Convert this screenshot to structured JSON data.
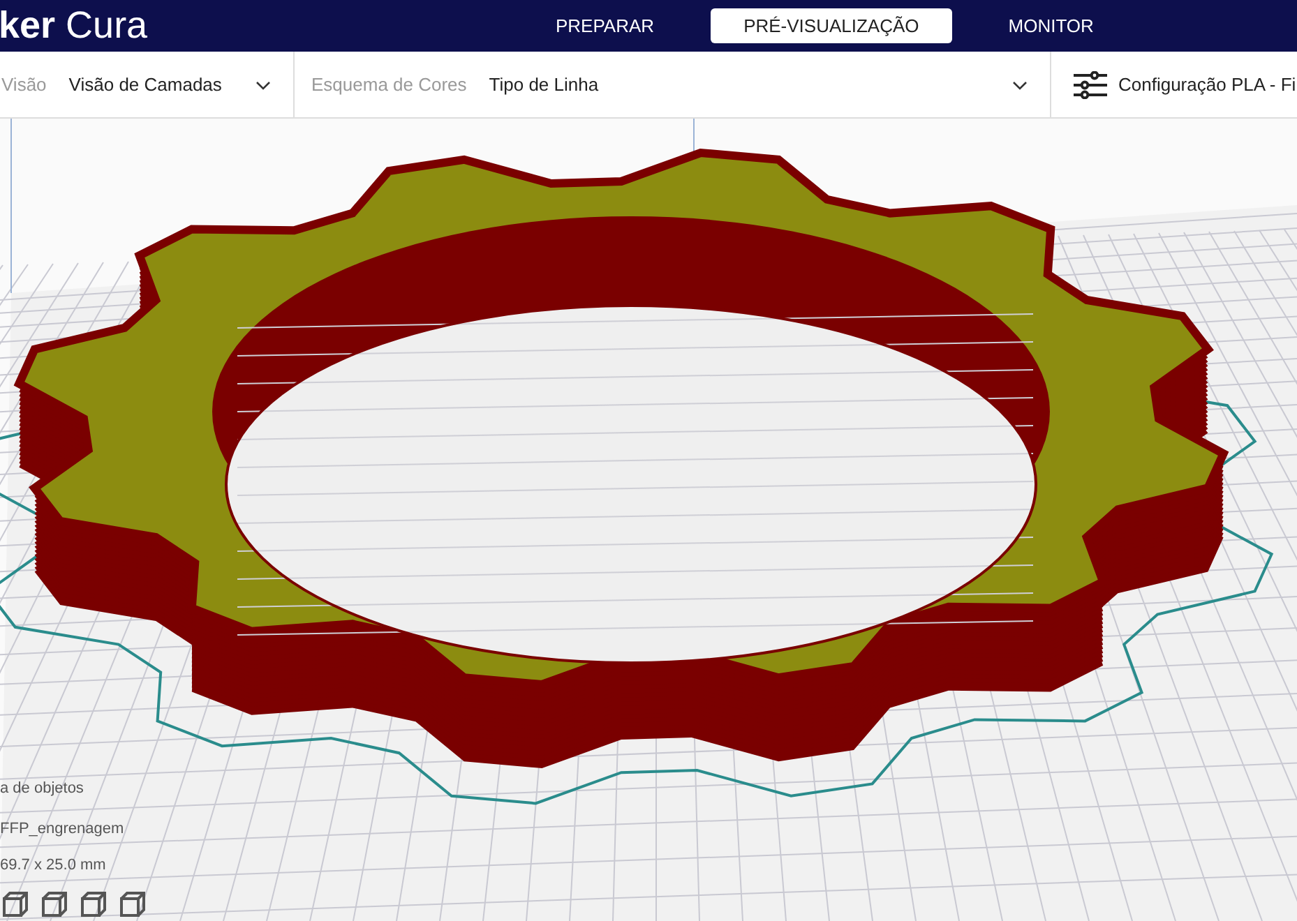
{
  "header": {
    "logo": "**ker** Cura",
    "tabs": [
      {
        "label": "PREPARAR",
        "selected": false
      },
      {
        "label": "PRÉ-VISUALIZAÇÃO",
        "selected": true
      },
      {
        "label": "MONITOR",
        "selected": false
      }
    ]
  },
  "toolbar": {
    "view": {
      "label": "Visão",
      "value": "Visão de Camadas"
    },
    "color_scheme": {
      "label": "Esquema de Cores",
      "value": "Tipo de Linha"
    },
    "print_settings": "Configuração PLA - Fi"
  },
  "object_list": {
    "title": "a de objetos",
    "name": "FFP_engrenagem",
    "dimensions": "69.7 x 25.0 mm"
  }
}
